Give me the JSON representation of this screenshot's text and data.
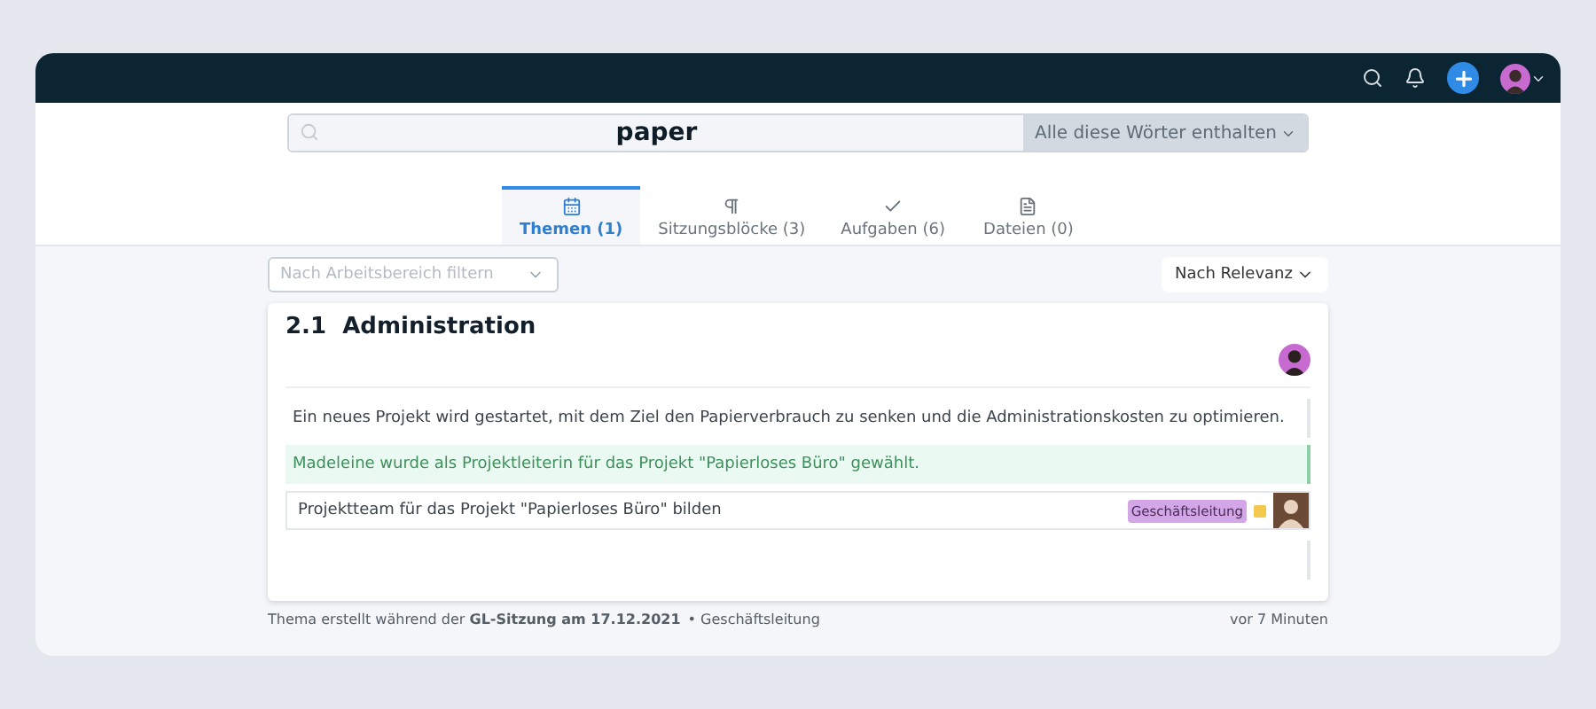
{
  "search": {
    "value": "paper",
    "mode": "Alle diese Wörter enthalten"
  },
  "tabs": [
    {
      "label": "Themen (1)",
      "kind": "calendar",
      "selected": true
    },
    {
      "label": "Sitzungsblöcke (3)",
      "kind": "paragraph",
      "selected": false
    },
    {
      "label": "Aufgaben (6)",
      "kind": "check",
      "selected": false
    },
    {
      "label": "Dateien (0)",
      "kind": "file",
      "selected": false
    }
  ],
  "filter": {
    "placeholder": "Nach Arbeitsbereich filtern"
  },
  "sort": "Nach Relevanz",
  "topic": {
    "number": "2.1",
    "title": "Administration",
    "items": [
      {
        "kind": "text",
        "text": "Ein neues Projekt wird gestartet, mit dem Ziel den Papierverbrauch zu senken und die Administrationskosten zu optimieren."
      },
      {
        "kind": "decision",
        "text": "Madeleine wurde als Projektleiterin für das Projekt \"Papierloses Büro\" gewählt."
      },
      {
        "kind": "task",
        "text": "Projektteam für das Projekt \"Papierloses Büro\" bilden",
        "tag": {
          "label": "Geschäftsleitung",
          "color": "#d3a6e8"
        },
        "color": "#f2c94c"
      }
    ]
  },
  "footer": {
    "left": "Thema erstellt während der **GL-Sitzung am 17.12.2021**",
    "group": "• Geschäftsleitung",
    "time": "vor 7 Minuten"
  }
}
